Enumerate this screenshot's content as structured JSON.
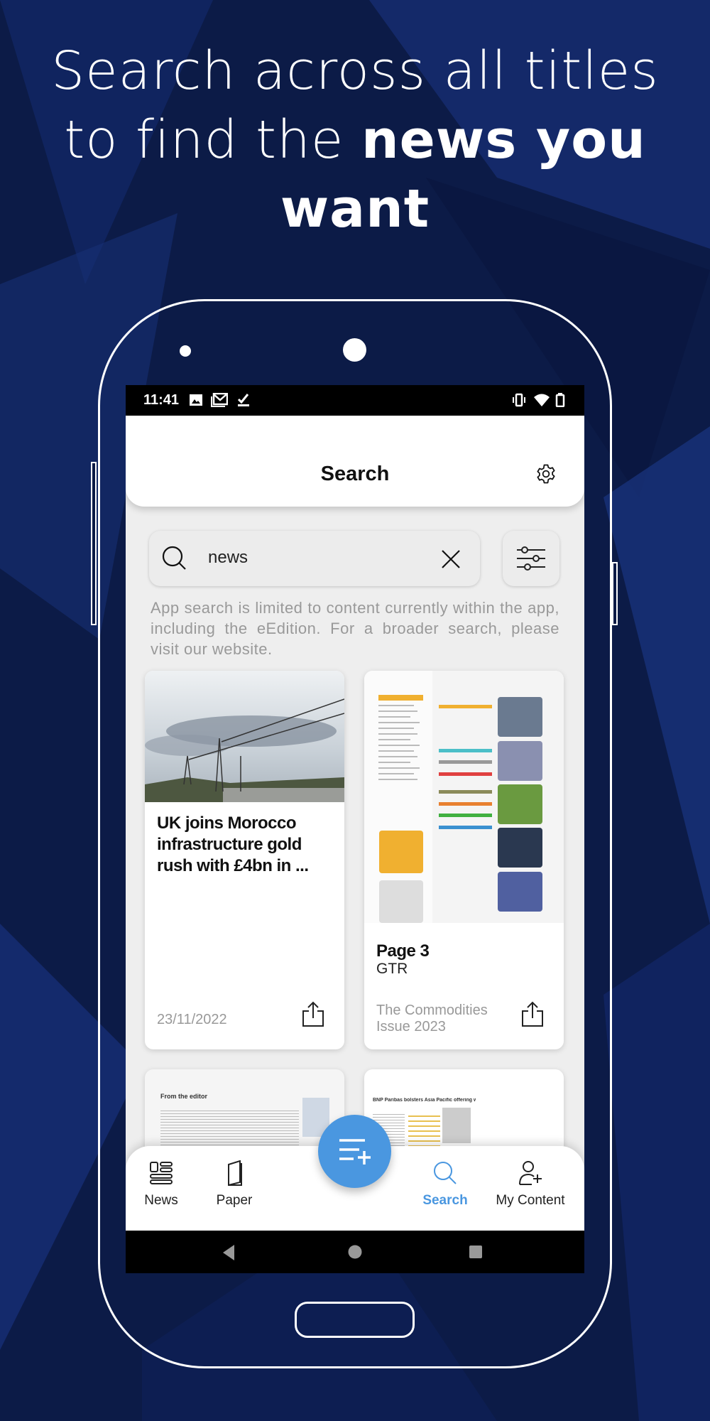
{
  "headline": {
    "line1": "Search across all titles",
    "line2_plain": "to find the ",
    "line2_bold": "news you",
    "line3_bold": "want"
  },
  "status_bar": {
    "time": "11:41",
    "left_icons": [
      "image-icon",
      "gmail-icon",
      "check-icon"
    ],
    "right_icons": [
      "vibrate-icon",
      "wifi-icon",
      "battery-icon"
    ]
  },
  "app_bar": {
    "title": "Search",
    "settings_icon": "gear-icon"
  },
  "search": {
    "value": "news",
    "clear_icon": "close-icon",
    "filter_icon": "sliders-icon"
  },
  "helper_text": "App search is limited to content currently within the app, including the eEdition. For a broader search, please visit our website.",
  "results": [
    {
      "title": "UK joins Morocco infrastructure gold rush with £4bn in ...",
      "date": "23/11/2022"
    },
    {
      "title": "Page 3",
      "subtitle": "GTR",
      "issue": "The Commodities Issue 2023"
    },
    {
      "preview_heading": "From the editor"
    },
    {
      "preview_heading": "BNP Paribas bolsters Asia Pacific offering with senior promotions"
    }
  ],
  "bottom_nav": {
    "items": [
      {
        "label": "News"
      },
      {
        "label": "Paper"
      },
      {
        "label": "Search",
        "active": true
      },
      {
        "label": "My Content"
      }
    ],
    "fab_icon": "playlist-add-icon"
  },
  "colors": {
    "accent": "#4a97e0",
    "background": "#0b1a45"
  }
}
